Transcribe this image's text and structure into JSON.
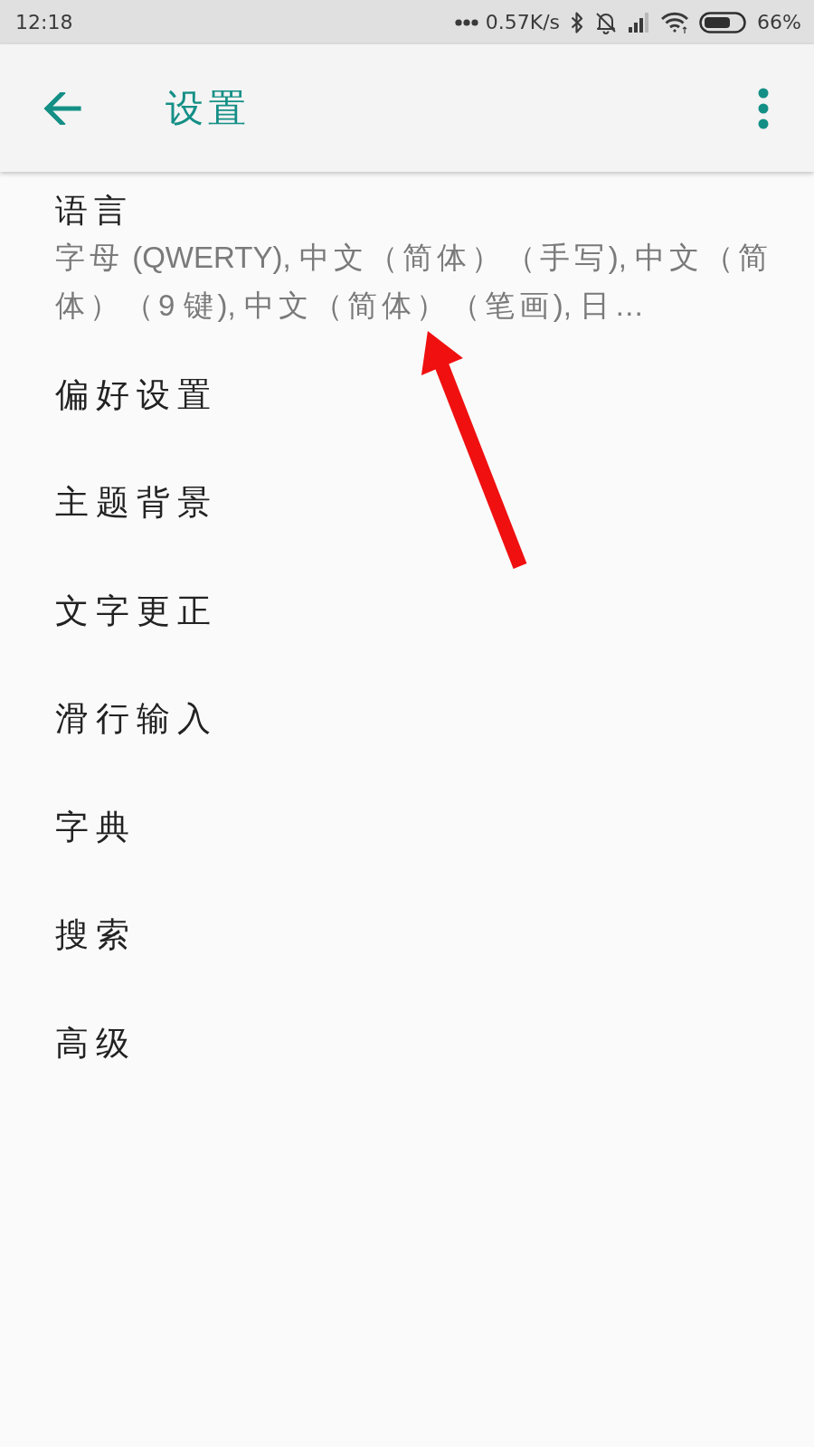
{
  "status_bar": {
    "time": "12:18",
    "network_speed": "0.57K/s",
    "battery": "66%"
  },
  "app_bar": {
    "title": "设置"
  },
  "settings": [
    {
      "title": "语言",
      "summary": "字母 (QWERTY), 中文（简体）（手写), 中文（简体）（9 键), 中文（简体）（笔画), 日…"
    },
    {
      "title": "偏好设置"
    },
    {
      "title": "主题背景"
    },
    {
      "title": "文字更正"
    },
    {
      "title": "滑行输入"
    },
    {
      "title": "字典"
    },
    {
      "title": "搜索"
    },
    {
      "title": "高级"
    }
  ]
}
